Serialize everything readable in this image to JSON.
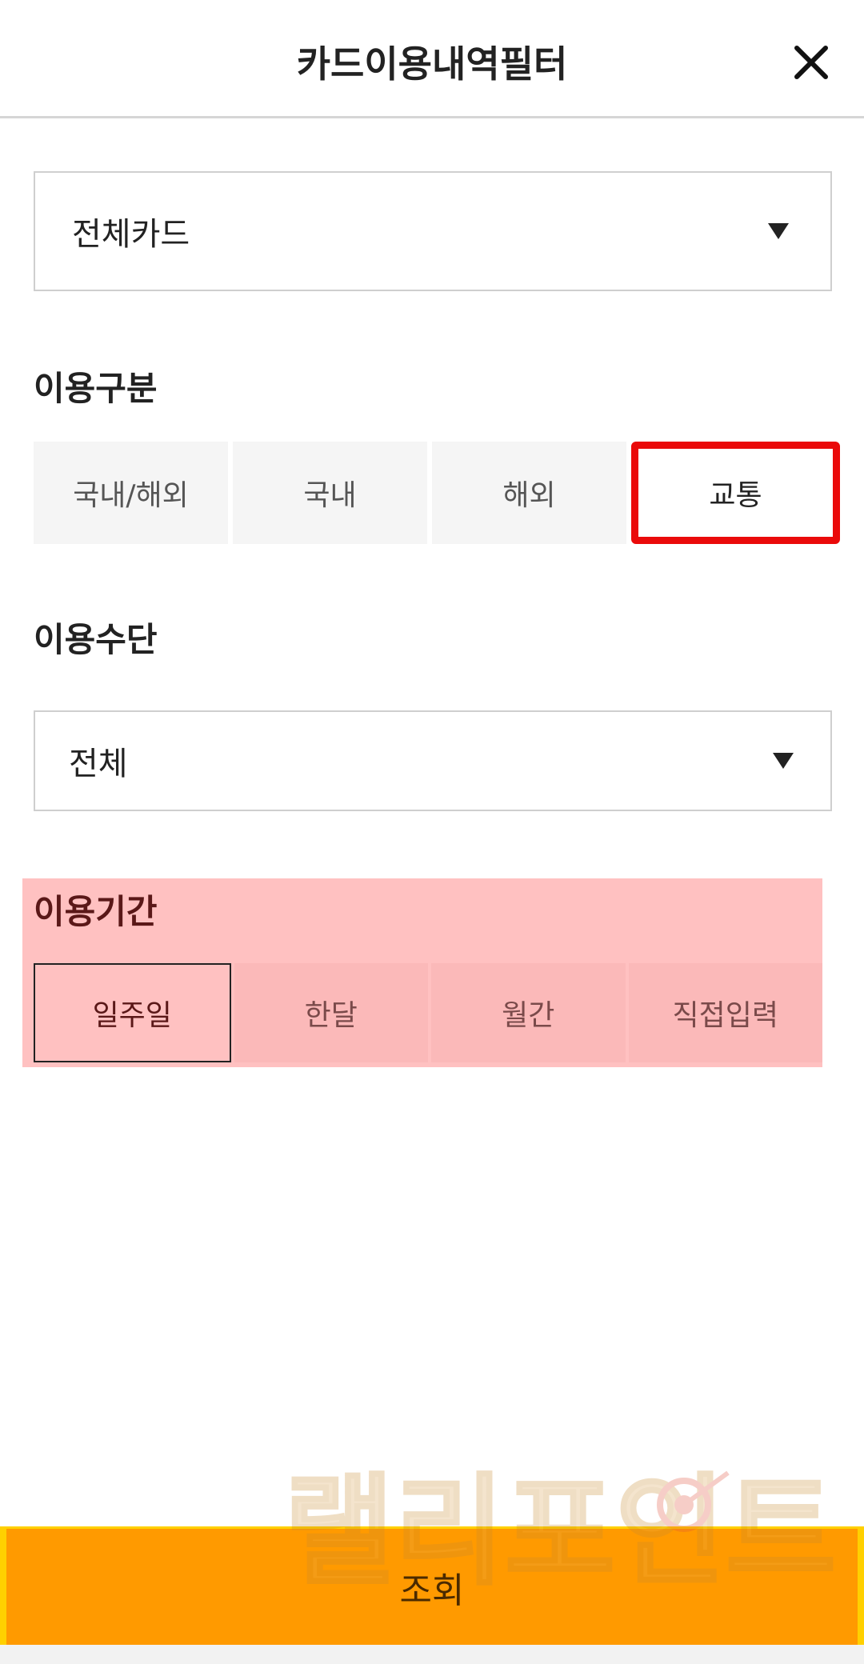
{
  "header": {
    "title": "카드이용내역필터",
    "close_icon": "close-icon"
  },
  "card_select": {
    "value": "전체카드",
    "arrow_icon": "caret-down-icon"
  },
  "usage_type": {
    "title": "이용구분",
    "options": [
      "국내/해외",
      "국내",
      "해외",
      "교통"
    ],
    "selected": "교통"
  },
  "usage_method": {
    "title": "이용수단",
    "value": "전체",
    "arrow_icon": "caret-down-icon"
  },
  "usage_period": {
    "title": "이용기간",
    "options": [
      "일주일",
      "한달",
      "월간",
      "직접입력"
    ],
    "selected": "일주일"
  },
  "submit": {
    "label": "조회"
  },
  "watermark": {
    "text": "랠리포인트"
  },
  "colors": {
    "highlight_red": "#ea0a0a",
    "period_overlay": "#ffc1c1",
    "submit_orange": "#ff9a00",
    "submit_border": "#ffd000"
  }
}
